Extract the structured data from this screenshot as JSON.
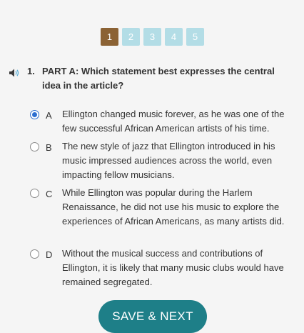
{
  "pager": {
    "pages": [
      "1",
      "2",
      "3",
      "4",
      "5"
    ],
    "active_page": "1"
  },
  "question": {
    "number": "1.",
    "text": "PART A: Which statement best expresses the central idea in the article?",
    "audio_icon": "speaker-icon"
  },
  "options": [
    {
      "letter": "A",
      "text": "Ellington changed music forever, as he was one of the few successful African American artists of his time.",
      "selected": true
    },
    {
      "letter": "B",
      "text": "The new style of jazz that Ellington introduced in his music impressed audiences across the world, even impacting fellow musicians.",
      "selected": false
    },
    {
      "letter": "C",
      "text": "While Ellington was popular during the Harlem Renaissance, he did not use his music to explore the experiences of African Americans, as many artists did.",
      "selected": false
    },
    {
      "letter": "D",
      "text": "Without the musical success and contributions of Ellington, it is likely that many music clubs would have remained segregated.",
      "selected": false
    }
  ],
  "actions": {
    "save_next_label": "SAVE & NEXT"
  },
  "colors": {
    "active_page": "#8b6234",
    "inactive_page": "#b3dde6",
    "primary_button": "#1e7f88",
    "radio_selected": "#2d6fd0"
  }
}
